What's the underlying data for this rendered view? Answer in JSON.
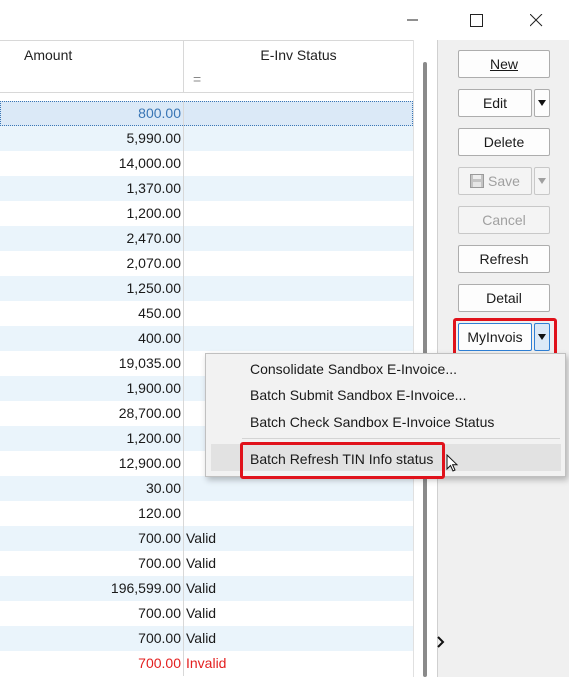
{
  "grid": {
    "header": {
      "amount": "Amount",
      "status": "E-Inv Status",
      "filter_symbol": "="
    },
    "rows": [
      {
        "amount": "800.00",
        "status": ""
      },
      {
        "amount": "5,990.00",
        "status": ""
      },
      {
        "amount": "14,000.00",
        "status": ""
      },
      {
        "amount": "1,370.00",
        "status": ""
      },
      {
        "amount": "1,200.00",
        "status": ""
      },
      {
        "amount": "2,470.00",
        "status": ""
      },
      {
        "amount": "2,070.00",
        "status": ""
      },
      {
        "amount": "1,250.00",
        "status": ""
      },
      {
        "amount": "450.00",
        "status": ""
      },
      {
        "amount": "400.00",
        "status": ""
      },
      {
        "amount": "19,035.00",
        "status": ""
      },
      {
        "amount": "1,900.00",
        "status": ""
      },
      {
        "amount": "28,700.00",
        "status": ""
      },
      {
        "amount": "1,200.00",
        "status": ""
      },
      {
        "amount": "12,900.00",
        "status": ""
      },
      {
        "amount": "30.00",
        "status": ""
      },
      {
        "amount": "120.00",
        "status": ""
      },
      {
        "amount": "700.00",
        "status": "Valid"
      },
      {
        "amount": "700.00",
        "status": "Valid"
      },
      {
        "amount": "196,599.00",
        "status": "Valid"
      },
      {
        "amount": "700.00",
        "status": "Valid"
      },
      {
        "amount": "700.00",
        "status": "Valid"
      },
      {
        "amount": "700.00",
        "status": "Invalid"
      }
    ]
  },
  "side": {
    "new": "New",
    "edit": "Edit",
    "delete": "Delete",
    "save": "Save",
    "cancel": "Cancel",
    "refresh": "Refresh",
    "detail": "Detail",
    "myinvois": "MyInvois"
  },
  "menu": {
    "items": [
      "Consolidate Sandbox E-Invoice...",
      "Batch Submit Sandbox E-Invoice...",
      "Batch Check Sandbox E-Invoice Status",
      "Batch Refresh TIN Info status"
    ]
  },
  "colors": {
    "highlight": "#e0121b",
    "invalid": "#e31f1f",
    "alt_row": "#eaf4fb"
  },
  "icons": [
    "minimize-icon",
    "maximize-icon",
    "close-icon",
    "save-icon",
    "chevron-down-icon",
    "mouse-cursor-icon"
  ]
}
